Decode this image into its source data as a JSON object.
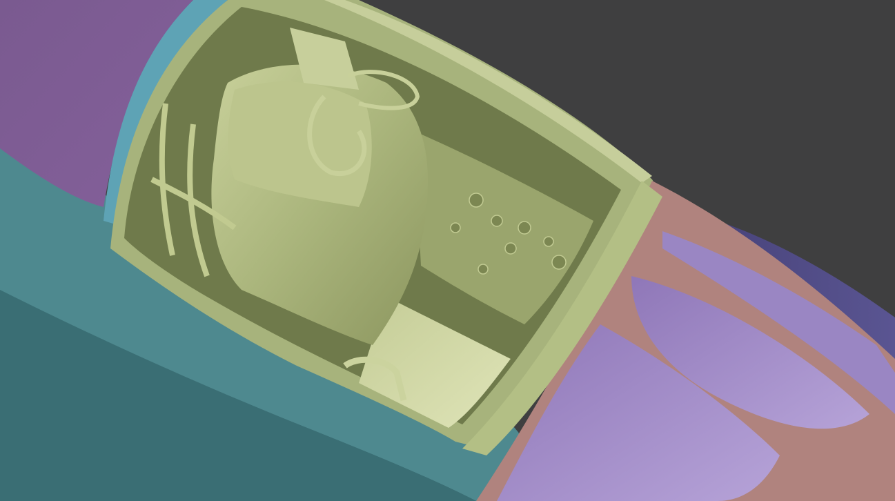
{
  "scene": {
    "subject": "cad-render-jet-cockpit",
    "colors": {
      "background": "#3f3f40",
      "fuselage_teal": "#4d878c",
      "fuselage_teal_dark": "#2f5f66",
      "fuselage_teal_light": "#6ea3a6",
      "fuselage_purple": "#7d5a93",
      "rim_blue": "#5ea3b5",
      "cockpit_green": "#b9c48c",
      "cockpit_green_dark": "#7f8a58",
      "cockpit_green_light": "#d4dca8",
      "canopy_frame_pink": "#b0837e",
      "canopy_glass_purple": "#9b82c3",
      "canopy_glass_light": "#b7a4d8",
      "nose_indigo": "#4f4a86"
    }
  }
}
